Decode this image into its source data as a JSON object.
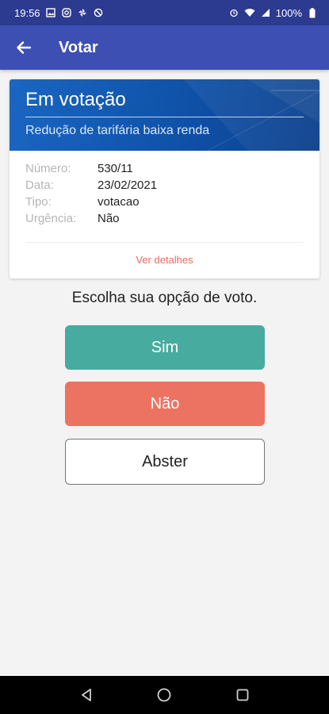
{
  "status_bar": {
    "time": "19:56",
    "battery": "100%",
    "left_icons": [
      "image-icon",
      "instagram-icon",
      "pinwheel-icon",
      "no-sync-icon"
    ],
    "right_icons": [
      "alarm-icon",
      "wifi-icon",
      "signal-icon",
      "battery-icon"
    ]
  },
  "app_bar": {
    "title": "Votar",
    "back_icon": "back-arrow-icon"
  },
  "card": {
    "status": "Em votação",
    "subtitle": "Redução de tarifária baixa renda",
    "fields": [
      {
        "label": "Número:",
        "value": "530/11"
      },
      {
        "label": "Data:",
        "value": "23/02/2021"
      },
      {
        "label": "Tipo:",
        "value": "votacao"
      },
      {
        "label": "Urgência:",
        "value": "Não"
      }
    ],
    "details_link": "Ver detalhes"
  },
  "prompt": "Escolha sua opção de voto.",
  "buttons": {
    "sim": "Sim",
    "nao": "Não",
    "abster": "Abster"
  },
  "colors": {
    "status_bar": "#2c3a8f",
    "app_bar": "#3e4fb3",
    "sim": "#47ab9f",
    "nao": "#ec7361",
    "link": "#e36f5b"
  },
  "nav_bar": {
    "buttons": [
      "back-triangle-icon",
      "home-circle-icon",
      "recents-square-icon"
    ]
  }
}
